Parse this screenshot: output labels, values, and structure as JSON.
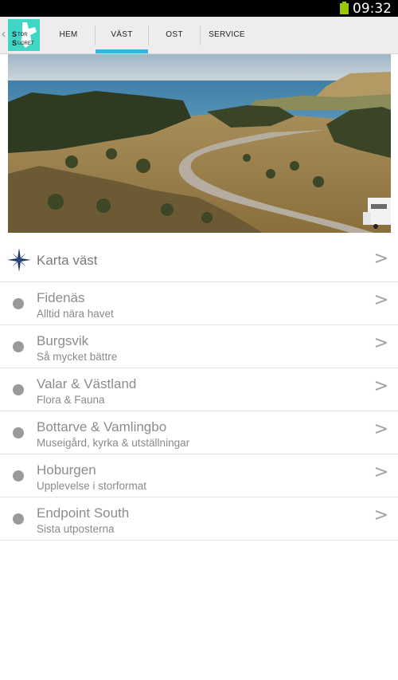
{
  "status": {
    "time": "09:32"
  },
  "appbar": {
    "logo_text_top": "STOR",
    "logo_text_bottom": "SUDRET",
    "tabs": [
      {
        "label": "HEM"
      },
      {
        "label": "VÄST"
      },
      {
        "label": "OST"
      },
      {
        "label": "SERVICE"
      }
    ],
    "selected_tab": "VÄST"
  },
  "colors": {
    "accent": "#33b5e5",
    "logo_bg": "#3fd6c6",
    "battery": "#98c800"
  },
  "list": {
    "header": {
      "title": "Karta väst",
      "icon": "compass-icon"
    },
    "items": [
      {
        "title": "Fidenäs",
        "subtitle": "Alltid nära havet"
      },
      {
        "title": "Burgsvik",
        "subtitle": "Så mycket bättre"
      },
      {
        "title": "Valar & Västland",
        "subtitle": "Flora & Fauna"
      },
      {
        "title": "Bottarve & Vamlingbo",
        "subtitle": "Museigård, kyrka & utställningar"
      },
      {
        "title": "Hoburgen",
        "subtitle": "Upplevelse i storformat"
      },
      {
        "title": "Endpoint South",
        "subtitle": "Sista utposterna"
      }
    ],
    "chevron": ">"
  }
}
